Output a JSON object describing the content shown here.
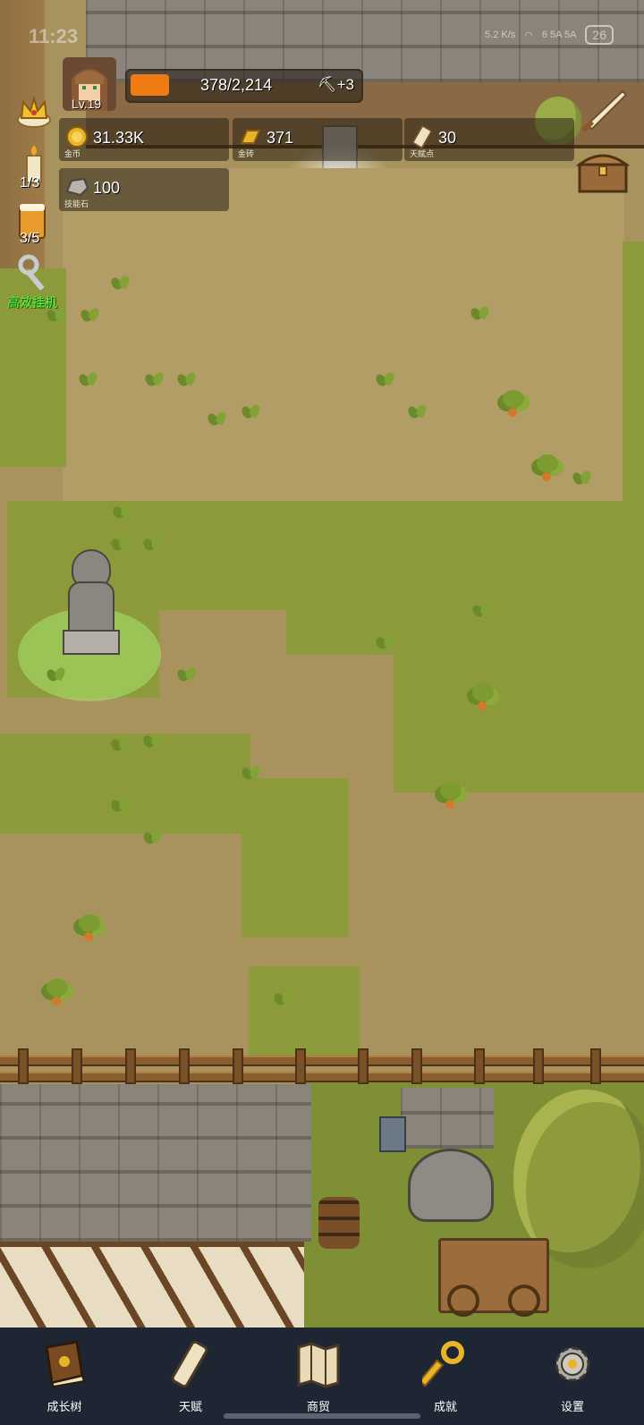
{
  "status_bar": {
    "time": "11:23",
    "net_speed": "5.2 K/s",
    "signal": "6 5A 5A",
    "battery": "26"
  },
  "player": {
    "level": "Lv.19",
    "xp_text": "378/2,214",
    "xp_fraction": 0.171,
    "xp_bonus": "+3"
  },
  "resources": [
    {
      "value": "31.33K",
      "label": "金币",
      "icon": "gold-coin-icon"
    },
    {
      "value": "371",
      "label": "金砖",
      "icon": "gold-bar-icon"
    },
    {
      "value": "30",
      "label": "天赋点",
      "icon": "talent-scroll-icon"
    },
    {
      "value": "100",
      "label": "技能石",
      "icon": "skill-stone-icon"
    }
  ],
  "side_buttons": {
    "crown": {
      "icon": "crown-icon"
    },
    "candle": {
      "icon": "candle-icon",
      "count": "1/3"
    },
    "beer": {
      "icon": "beer-mug-icon",
      "count": "3/5"
    },
    "afk": {
      "icon": "wrench-icon",
      "label": "高效挂机"
    },
    "sword": {
      "icon": "sword-icon"
    },
    "chest": {
      "icon": "treasure-chest-icon"
    }
  },
  "nav": [
    {
      "label": "成长树",
      "icon": "book-icon"
    },
    {
      "label": "天赋",
      "icon": "scroll-icon"
    },
    {
      "label": "商贸",
      "icon": "map-icon"
    },
    {
      "label": "成就",
      "icon": "key-icon"
    },
    {
      "label": "设置",
      "icon": "gear-icon"
    }
  ],
  "colors": {
    "xp_fill": "#ef7b12",
    "afk_label": "#4bff3a",
    "nav_bg": "#1f2633"
  }
}
